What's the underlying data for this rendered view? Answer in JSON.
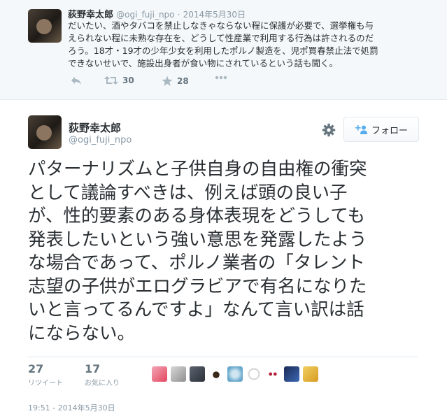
{
  "parent_tweet": {
    "name": "荻野幸太郎",
    "handle": "@ogi_fuji_npo",
    "dot": "·",
    "date": "2014年5月30日",
    "lines": [
      "だいたい、酒やタバコを禁止しなきゃならない程に保護が必要で、選挙権も与",
      "えられない程に未熟な存在を、どうして性産業で利用する行為は許されるのだ",
      "ろう。18才・19才の少年少女を利用したポルノ製造を、児ポ買春禁止法で処罰",
      "できないせいで、施設出身者が食い物にされているという話も聞く。"
    ],
    "retweet_count": "30",
    "favorite_count": "28"
  },
  "main_tweet": {
    "name": "荻野幸太郎",
    "handle": "@ogi_fuji_npo",
    "follow_label": "フォロー",
    "lines": [
      "パターナリズムと子供自身の自由権の衝突",
      "として議論すべきは、例えば頭の良い子",
      "が、性的要素のある身体表現をどうしても",
      "発表したいという強い意思を発露したよう",
      "な場合であって、ポルノ業者の「タレント",
      "志望の子供がエログラビアで有名になりた",
      "いと言ってるんですよ」なんて言い訳は話",
      "にならない。"
    ],
    "stats": {
      "retweets": "27",
      "retweets_label": "リツイート",
      "favorites": "17",
      "favorites_label": "お気に入り"
    },
    "timestamp": "19:51 - 2014年5月30日"
  },
  "colors": {
    "text": "#292f33",
    "muted": "#8899a6",
    "border": "#e1e8ed",
    "parent_bg": "#f5f8fa"
  },
  "icons": [
    "reply-icon",
    "retweet-icon",
    "star-icon",
    "more-icon",
    "gear-icon",
    "follow-user-icon"
  ]
}
